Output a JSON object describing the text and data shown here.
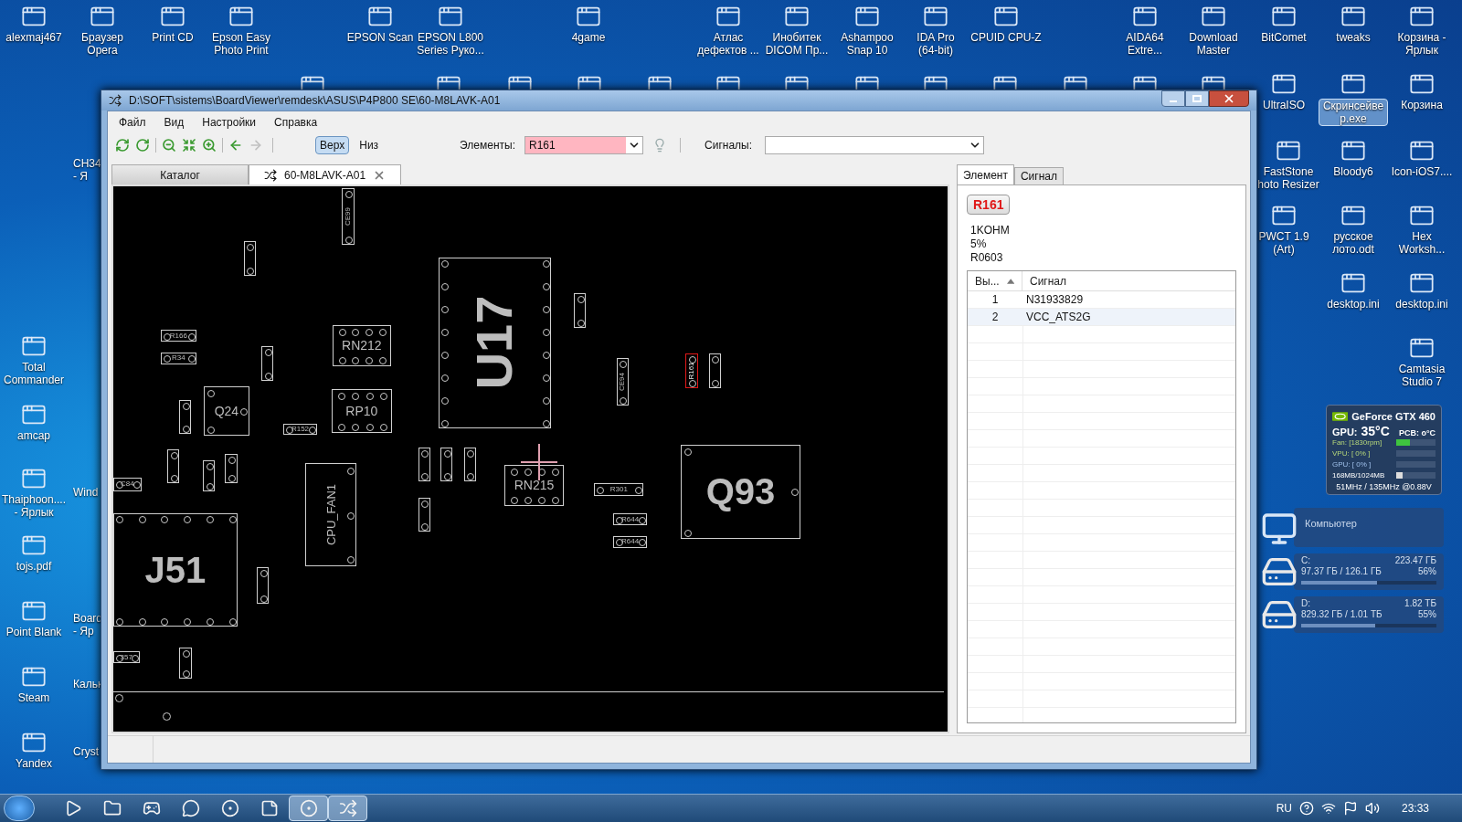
{
  "desktop_icons": [
    {
      "lines": [
        "alexmaj467"
      ],
      "selected": false
    },
    {
      "lines": [
        "Браузер",
        "Opera"
      ],
      "selected": false
    },
    {
      "lines": [
        "Print CD"
      ],
      "selected": false
    },
    {
      "lines": [
        "Epson Easy",
        "Photo Print"
      ],
      "selected": false
    },
    {
      "lines": [
        "EPSON Scan"
      ],
      "selected": false
    },
    {
      "lines": [
        "EPSON L800",
        "Series Руко..."
      ],
      "selected": false
    },
    {
      "lines": [
        "4game"
      ],
      "selected": false
    },
    {
      "lines": [
        "Атлас",
        "дефектов ..."
      ],
      "selected": false
    },
    {
      "lines": [
        "Инобитек",
        "DICOM Пр..."
      ],
      "selected": false
    },
    {
      "lines": [
        "Ashampoo",
        "Snap 10"
      ],
      "selected": false
    },
    {
      "lines": [
        "IDA Pro",
        "(64-bit)"
      ],
      "selected": false
    },
    {
      "lines": [
        "CPUID CPU-Z"
      ],
      "selected": false
    },
    {
      "lines": [
        "AIDA64",
        "Extre..."
      ],
      "selected": false
    },
    {
      "lines": [
        "Download",
        "Master"
      ],
      "selected": false
    },
    {
      "lines": [
        "BitComet"
      ],
      "selected": false
    },
    {
      "lines": [
        "tweaks"
      ],
      "selected": false
    },
    {
      "lines": [
        "Корзина -",
        "Ярлык"
      ],
      "selected": false
    },
    {
      "lines": [
        "UltraISO"
      ],
      "selected": false
    },
    {
      "lines": [
        "Скринсейве",
        "р.exe"
      ],
      "selected": true
    },
    {
      "lines": [
        "Корзина"
      ],
      "selected": false
    },
    {
      "lines": [
        "Total",
        "Commander"
      ],
      "selected": false
    },
    {
      "lines": [
        "amcap"
      ],
      "selected": false
    },
    {
      "lines": [
        "Thaiphoon....",
        "- Ярлык"
      ],
      "selected": false
    },
    {
      "lines": [
        "tojs.pdf"
      ],
      "selected": false
    },
    {
      "lines": [
        "Point Blank"
      ],
      "selected": false
    },
    {
      "lines": [
        "Steam"
      ],
      "selected": false
    },
    {
      "lines": [
        "Yandex"
      ],
      "selected": false
    },
    {
      "lines": [
        "FastStone",
        "hoto Resizer"
      ],
      "selected": false
    },
    {
      "lines": [
        "Bloody6"
      ],
      "selected": false
    },
    {
      "lines": [
        "Icon-iOS7...."
      ],
      "selected": false
    },
    {
      "lines": [
        "PWCT 1.9",
        "(Art)"
      ],
      "selected": false
    },
    {
      "lines": [
        "русское",
        "лото.odt"
      ],
      "selected": false
    },
    {
      "lines": [
        "Hex",
        "Worksh..."
      ],
      "selected": false
    },
    {
      "lines": [
        "desktop.ini"
      ],
      "selected": false
    },
    {
      "lines": [
        "desktop.ini"
      ],
      "selected": false
    },
    {
      "lines": [
        "Camtasia",
        "Studio 7"
      ],
      "selected": false
    }
  ],
  "covered_icon_labels": [
    {
      "lines": [
        "CH34",
        "- Я"
      ]
    },
    {
      "lines": [
        "Wind"
      ]
    },
    {
      "lines": [
        "Board",
        "- Яр"
      ]
    },
    {
      "lines": [
        "Кальк"
      ]
    },
    {
      "lines": [
        "Cryst"
      ]
    }
  ],
  "window": {
    "title": "D:\\SOFT\\sistems\\BoardViewer\\remdesk\\ASUS\\P4P800 SE\\60-M8LAVK-A01",
    "menu": [
      "Файл",
      "Вид",
      "Настройки",
      "Справка"
    ],
    "toolbar": [
      {
        "kind": "reload",
        "disabled": false
      },
      {
        "kind": "redo",
        "disabled": false
      },
      {
        "kind": "zoom-out",
        "disabled": false
      },
      {
        "kind": "fit",
        "disabled": false
      },
      {
        "kind": "zoom-in",
        "disabled": false
      },
      {
        "kind": "back",
        "disabled": false
      },
      {
        "kind": "forward",
        "disabled": true
      }
    ],
    "sides": [
      {
        "label": "Верх",
        "selected": true
      },
      {
        "label": "Низ",
        "selected": false
      }
    ],
    "elements": {
      "label": "Элементы:",
      "value": "R161"
    },
    "signals": {
      "label": "Сигналы:"
    },
    "tabs": [
      {
        "label": "Каталог",
        "selected": false,
        "closable": false
      },
      {
        "label": "60-M8LAVK-A01",
        "selected": true,
        "closable": true
      }
    ],
    "board": {
      "components": [
        {
          "kind": "part",
          "label": "CE99",
          "selected": false
        },
        {
          "kind": "part",
          "selected": false
        },
        {
          "kind": "part",
          "label": "R166",
          "selected": false
        },
        {
          "kind": "part",
          "label": "R34",
          "selected": false
        },
        {
          "kind": "part",
          "selected": false
        },
        {
          "kind": "chip",
          "label": "RN212",
          "selected": false
        },
        {
          "kind": "ic",
          "label": "U17",
          "selected": false
        },
        {
          "kind": "part",
          "selected": false
        },
        {
          "kind": "transistor",
          "label": "Q24",
          "selected": false
        },
        {
          "kind": "part",
          "selected": false
        },
        {
          "kind": "chip",
          "label": "RP10",
          "selected": false
        },
        {
          "kind": "part",
          "label": "R152",
          "selected": false
        },
        {
          "kind": "part",
          "label": "CE94",
          "selected": false
        },
        {
          "kind": "part",
          "label": "R161",
          "selected": true
        },
        {
          "kind": "part",
          "selected": false
        },
        {
          "kind": "part",
          "selected": false
        },
        {
          "kind": "part",
          "selected": false
        },
        {
          "kind": "part",
          "selected": false
        },
        {
          "kind": "part",
          "label": "C84",
          "selected": false
        },
        {
          "kind": "connector",
          "label": "CPU_FAN1",
          "selected": false
        },
        {
          "kind": "part",
          "selected": false
        },
        {
          "kind": "part",
          "selected": false
        },
        {
          "kind": "part",
          "selected": false
        },
        {
          "kind": "chip",
          "label": "RN215",
          "selected": false
        },
        {
          "kind": "part",
          "label": "R301",
          "selected": false
        },
        {
          "kind": "part",
          "label": "R644",
          "selected": false
        },
        {
          "kind": "part",
          "label": "R644",
          "selected": false
        },
        {
          "kind": "transistor",
          "label": "Q93",
          "selected": false
        },
        {
          "kind": "part",
          "selected": false
        },
        {
          "kind": "connector",
          "label": "J51",
          "selected": false
        },
        {
          "kind": "part",
          "selected": false
        },
        {
          "kind": "part",
          "label": "357",
          "selected": false
        },
        {
          "kind": "part",
          "selected": false
        }
      ]
    },
    "details": {
      "tabs": [
        {
          "label": "Элемент",
          "selected": true
        },
        {
          "label": "Сигнал",
          "selected": false
        }
      ],
      "part": "R161",
      "properties": [
        "1KOHM",
        "5%",
        "R0603"
      ],
      "columns": [
        {
          "label": "Вы...",
          "sorted": true
        },
        {
          "label": "Сигнал",
          "sorted": false
        }
      ],
      "rows": [
        {
          "pin": "1",
          "signal": "N31933829"
        },
        {
          "pin": "2",
          "signal": "VCC_ATS2G"
        }
      ]
    }
  },
  "gpu_gadget": {
    "title": "GeForce GTX 460",
    "gpu_label": "GPU:",
    "temp": "35°C",
    "pcb": "PCB: o°C",
    "meters": [
      {
        "label": "Fan: [1830rpm]",
        "level": 0.35
      },
      {
        "label": "VPU: [ 0% ]",
        "level": 0
      },
      {
        "label": "GPU: [ 0% ]",
        "level": 0
      },
      {
        "label": "168MB/1024MB",
        "level": 0.16
      }
    ],
    "clocks": "51MHz / 135MHz @0.88V"
  },
  "computer_gadget": {
    "title": "Компьютер",
    "drives": [
      {
        "name": "C:",
        "total": "223.47 ГБ",
        "usage": "97.37 ГБ / 126.1 ГБ",
        "percent": "56%",
        "level": 0.56
      },
      {
        "name": "D:",
        "total": "1.82 ТБ",
        "usage": "829.32 ГБ / 1.01 ТБ",
        "percent": "55%",
        "level": 0.55
      }
    ]
  },
  "taskbar": {
    "apps": [
      {
        "kind": "player",
        "active": false
      },
      {
        "kind": "folder",
        "active": false
      },
      {
        "kind": "game",
        "active": false
      },
      {
        "kind": "chat",
        "active": false
      },
      {
        "kind": "opera",
        "active": false
      },
      {
        "kind": "notes",
        "active": false
      },
      {
        "kind": "yandex",
        "active": true
      },
      {
        "kind": "boardviewer",
        "active": true
      }
    ],
    "language": "RU",
    "time": "23:33"
  }
}
